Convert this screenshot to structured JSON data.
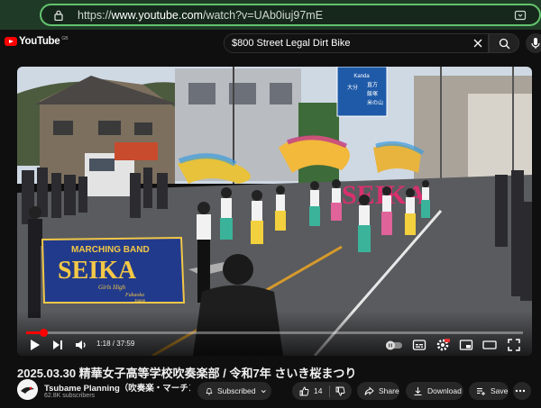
{
  "browser": {
    "url_prefix": "https://",
    "url_host": "www.youtube.com",
    "url_path": "/watch?v=UAb0iuj97mE"
  },
  "masthead": {
    "logo_text": "YouTube",
    "country_code": "GB",
    "search_query": "$800 Street Legal Dirt Bike"
  },
  "scene": {
    "banner_line1": "MARCHING BAND",
    "banner_line2": "SEIKA",
    "banner_line3": "Girls High",
    "banner_line4": "Fukuoka",
    "banner_line5": "Japan",
    "flag_text": "SEIKA",
    "sign_line1": "Kanda",
    "sign_line2": "大分",
    "sign_line3": "直方",
    "sign_line4": "飯塚",
    "sign_line5": "米の山"
  },
  "player": {
    "time_current": "1:18",
    "time_separator": " / ",
    "time_total": "37:59",
    "progress_fraction": 0.034
  },
  "video": {
    "title": "2025.03.30 精華女子高等学校吹奏楽部 / 令和7年 さいき桜まつり",
    "channel_name": "Tsubame Planning（吹奏楽・マーチン…",
    "subscribers": "62.8K subscribers",
    "subscribe_label": "Subscribed",
    "like_count": "14",
    "share_label": "Share",
    "download_label": "Download",
    "save_label": "Save"
  },
  "colors": {
    "accent_red": "#ff0000",
    "background": "#0f0f0f",
    "pill": "#272727",
    "browser_frame": "#1f3a26",
    "url_outline": "#63c26e"
  },
  "icons": [
    "lock-icon",
    "reader-view-icon",
    "youtube-logo-icon",
    "close-icon",
    "search-icon",
    "mic-icon",
    "play-icon",
    "next-icon",
    "volume-icon",
    "autoplay-toggle-icon",
    "subtitles-icon",
    "settings-icon",
    "miniplayer-icon",
    "theater-icon",
    "fullscreen-icon",
    "bell-icon",
    "chevron-down-icon",
    "like-icon",
    "dislike-icon",
    "share-icon",
    "download-icon",
    "save-icon",
    "more-icon"
  ]
}
